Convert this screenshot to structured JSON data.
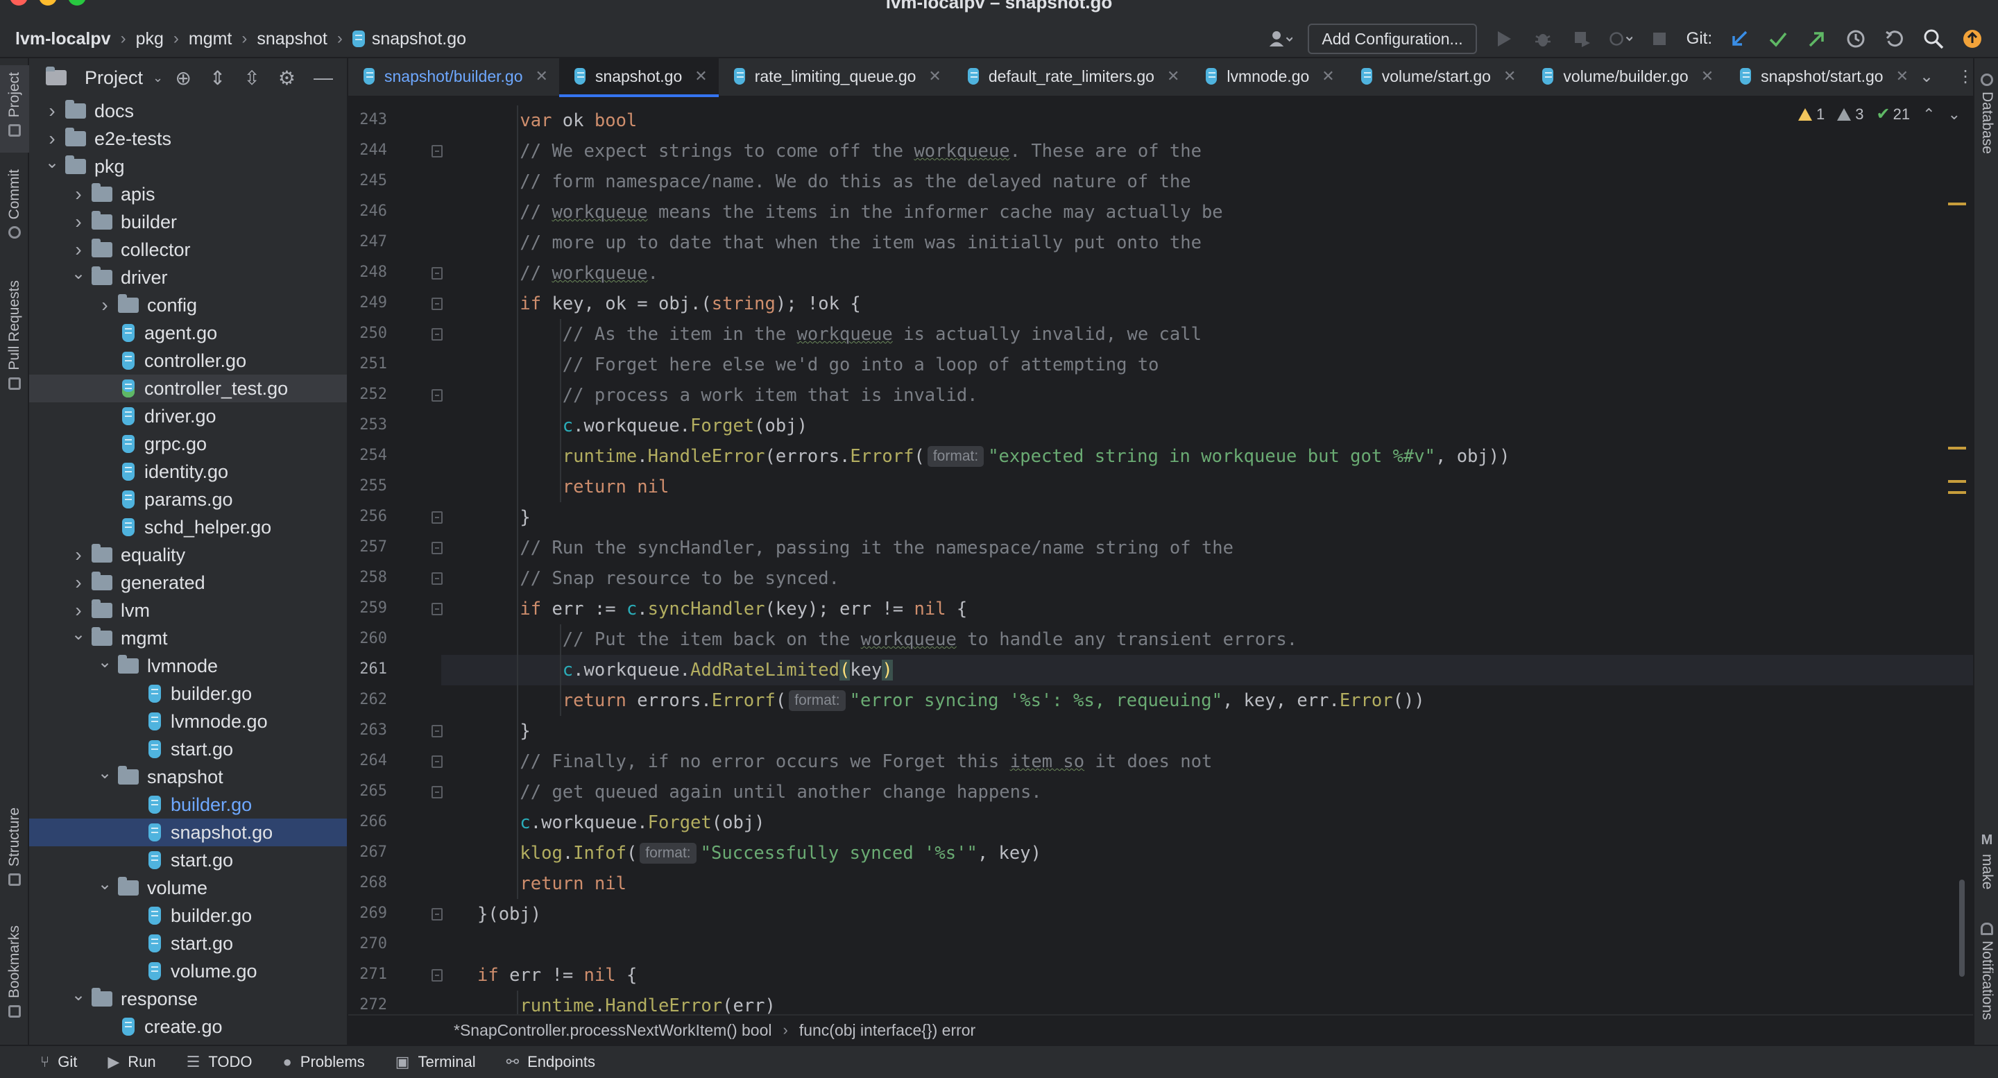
{
  "window": {
    "title": "lvm-localpv – snapshot.go"
  },
  "navbar": {
    "crumbs": [
      "lvm-localpv",
      "pkg",
      "mgmt",
      "snapshot",
      "snapshot.go"
    ],
    "add_configuration": "Add Configuration...",
    "git_label": "Git:"
  },
  "left_stripe": {
    "tabs": [
      "Project",
      "Commit",
      "Pull Requests",
      "Structure",
      "Bookmarks"
    ]
  },
  "right_stripe": {
    "tabs": [
      "Database",
      "make",
      "Notifications"
    ]
  },
  "project_panel": {
    "title": "Project",
    "tree": [
      {
        "label": "docs",
        "type": "folder",
        "depth": 0,
        "open": false
      },
      {
        "label": "e2e-tests",
        "type": "folder",
        "depth": 0,
        "open": false
      },
      {
        "label": "pkg",
        "type": "folder",
        "depth": 0,
        "open": true
      },
      {
        "label": "apis",
        "type": "folder",
        "depth": 1,
        "open": false
      },
      {
        "label": "builder",
        "type": "folder",
        "depth": 1,
        "open": false
      },
      {
        "label": "collector",
        "type": "folder",
        "depth": 1,
        "open": false
      },
      {
        "label": "driver",
        "type": "folder",
        "depth": 1,
        "open": true
      },
      {
        "label": "config",
        "type": "folder",
        "depth": 2,
        "open": false
      },
      {
        "label": "agent.go",
        "type": "go",
        "depth": 2
      },
      {
        "label": "controller.go",
        "type": "go",
        "depth": 2
      },
      {
        "label": "controller_test.go",
        "type": "go-test",
        "depth": 2,
        "state": "hover"
      },
      {
        "label": "driver.go",
        "type": "go",
        "depth": 2
      },
      {
        "label": "grpc.go",
        "type": "go",
        "depth": 2
      },
      {
        "label": "identity.go",
        "type": "go",
        "depth": 2
      },
      {
        "label": "params.go",
        "type": "go",
        "depth": 2
      },
      {
        "label": "schd_helper.go",
        "type": "go",
        "depth": 2
      },
      {
        "label": "equality",
        "type": "folder",
        "depth": 1,
        "open": false
      },
      {
        "label": "generated",
        "type": "folder",
        "depth": 1,
        "open": false
      },
      {
        "label": "lvm",
        "type": "folder",
        "depth": 1,
        "open": false
      },
      {
        "label": "mgmt",
        "type": "folder",
        "depth": 1,
        "open": true
      },
      {
        "label": "lvmnode",
        "type": "folder",
        "depth": 2,
        "open": true
      },
      {
        "label": "builder.go",
        "type": "go",
        "depth": 3
      },
      {
        "label": "lvmnode.go",
        "type": "go",
        "depth": 3
      },
      {
        "label": "start.go",
        "type": "go",
        "depth": 3
      },
      {
        "label": "snapshot",
        "type": "folder",
        "depth": 2,
        "open": true
      },
      {
        "label": "builder.go",
        "type": "go",
        "depth": 3,
        "state": "link"
      },
      {
        "label": "snapshot.go",
        "type": "go",
        "depth": 3,
        "state": "selected"
      },
      {
        "label": "start.go",
        "type": "go",
        "depth": 3
      },
      {
        "label": "volume",
        "type": "folder",
        "depth": 2,
        "open": true
      },
      {
        "label": "builder.go",
        "type": "go",
        "depth": 3
      },
      {
        "label": "start.go",
        "type": "go",
        "depth": 3
      },
      {
        "label": "volume.go",
        "type": "go",
        "depth": 3
      },
      {
        "label": "response",
        "type": "folder",
        "depth": 1,
        "open": true
      },
      {
        "label": "create.go",
        "type": "go",
        "depth": 2
      }
    ]
  },
  "tabs": [
    {
      "label": "snapshot/builder.go",
      "state": "blue"
    },
    {
      "label": "snapshot.go",
      "state": "active"
    },
    {
      "label": "rate_limiting_queue.go",
      "state": "normal"
    },
    {
      "label": "default_rate_limiters.go",
      "state": "normal"
    },
    {
      "label": "lvmnode.go",
      "state": "normal"
    },
    {
      "label": "volume/start.go",
      "state": "normal"
    },
    {
      "label": "volume/builder.go",
      "state": "normal"
    },
    {
      "label": "snapshot/start.go",
      "state": "normal"
    }
  ],
  "inspections": {
    "warnings": "1",
    "weak_warnings": "3",
    "ok": "21"
  },
  "editor": {
    "current_line": 261,
    "lines": [
      {
        "n": 243,
        "indent": 2,
        "fold": false,
        "tokens": [
          [
            "kw",
            "var"
          ],
          [
            "ident",
            " ok "
          ],
          [
            "kw",
            "bool"
          ]
        ]
      },
      {
        "n": 244,
        "indent": 2,
        "fold": true,
        "tokens": [
          [
            "cm",
            "// We expect strings to come off the "
          ],
          [
            "cmtypo",
            "workqueue"
          ],
          [
            "cm",
            ". These are of the"
          ]
        ]
      },
      {
        "n": 245,
        "indent": 2,
        "fold": false,
        "tokens": [
          [
            "cm",
            "// form namespace/name. We do this as the delayed nature of the"
          ]
        ]
      },
      {
        "n": 246,
        "indent": 2,
        "fold": false,
        "tokens": [
          [
            "cm",
            "// "
          ],
          [
            "cmtypo",
            "workqueue"
          ],
          [
            "cm",
            " means the items in the informer cache may actually be"
          ]
        ]
      },
      {
        "n": 247,
        "indent": 2,
        "fold": false,
        "tokens": [
          [
            "cm",
            "// more up to date that when the item was initially put onto the"
          ]
        ]
      },
      {
        "n": 248,
        "indent": 2,
        "fold": true,
        "tokens": [
          [
            "cm",
            "// "
          ],
          [
            "cmtypo",
            "workqueue"
          ],
          [
            "cm",
            "."
          ]
        ]
      },
      {
        "n": 249,
        "indent": 2,
        "fold": true,
        "tokens": [
          [
            "kw",
            "if"
          ],
          [
            "ident",
            " key, ok = obj.("
          ],
          [
            "kw",
            "string"
          ],
          [
            "ident",
            "); !ok {"
          ]
        ]
      },
      {
        "n": 250,
        "indent": 3,
        "fold": true,
        "tokens": [
          [
            "cm",
            "// As the item in the "
          ],
          [
            "cmtypo",
            "workqueue"
          ],
          [
            "cm",
            " is actually invalid, we call"
          ]
        ]
      },
      {
        "n": 251,
        "indent": 3,
        "fold": false,
        "tokens": [
          [
            "cm",
            "// Forget here else we'd go into a loop of attempting to"
          ]
        ]
      },
      {
        "n": 252,
        "indent": 3,
        "fold": true,
        "tokens": [
          [
            "cm",
            "// process a work item that is invalid."
          ]
        ]
      },
      {
        "n": 253,
        "indent": 3,
        "fold": false,
        "tokens": [
          [
            "cyan",
            "c"
          ],
          [
            "ident",
            "."
          ],
          [
            "ident",
            "workqueue."
          ],
          [
            "golden",
            "Forget"
          ],
          [
            "ident",
            "(obj)"
          ]
        ]
      },
      {
        "n": 254,
        "indent": 3,
        "fold": false,
        "tokens": [
          [
            "golden",
            "runtime"
          ],
          [
            "ident",
            "."
          ],
          [
            "golden",
            "HandleError"
          ],
          [
            "ident",
            "(errors."
          ],
          [
            "golden",
            "Errorf"
          ],
          [
            "ident",
            "("
          ],
          [
            "hint",
            "format:"
          ],
          [
            "str",
            "\"expected string in workqueue but got %#v\""
          ],
          [
            "ident",
            ", obj))"
          ]
        ]
      },
      {
        "n": 255,
        "indent": 3,
        "fold": false,
        "tokens": [
          [
            "kw",
            "return"
          ],
          [
            "ident",
            " "
          ],
          [
            "kw",
            "nil"
          ]
        ]
      },
      {
        "n": 256,
        "indent": 2,
        "fold": true,
        "tokens": [
          [
            "ident",
            "}"
          ]
        ]
      },
      {
        "n": 257,
        "indent": 2,
        "fold": true,
        "tokens": [
          [
            "cm",
            "// Run the syncHandler, passing it the namespace/name string of the"
          ]
        ]
      },
      {
        "n": 258,
        "indent": 2,
        "fold": true,
        "tokens": [
          [
            "cm",
            "// Snap resource to be synced."
          ]
        ]
      },
      {
        "n": 259,
        "indent": 2,
        "fold": true,
        "tokens": [
          [
            "kw",
            "if"
          ],
          [
            "ident",
            " err := "
          ],
          [
            "cyan",
            "c"
          ],
          [
            "ident",
            "."
          ],
          [
            "golden",
            "syncHandler"
          ],
          [
            "ident",
            "(key); err != "
          ],
          [
            "kw",
            "nil"
          ],
          [
            "ident",
            " {"
          ]
        ]
      },
      {
        "n": 260,
        "indent": 3,
        "fold": false,
        "tokens": [
          [
            "cm",
            "// Put the item back on the "
          ],
          [
            "cmtypo",
            "workqueue"
          ],
          [
            "cm",
            " to handle any transient errors."
          ]
        ]
      },
      {
        "n": 261,
        "indent": 3,
        "fold": false,
        "tokens": [
          [
            "cyan",
            "c"
          ],
          [
            "ident",
            "."
          ],
          [
            "ident",
            "workqueue."
          ],
          [
            "golden",
            "AddRateLimited"
          ],
          [
            "bracehl",
            "("
          ],
          [
            "ident",
            "key"
          ],
          [
            "bracehl",
            ")"
          ]
        ]
      },
      {
        "n": 262,
        "indent": 3,
        "fold": false,
        "tokens": [
          [
            "kw",
            "return"
          ],
          [
            "ident",
            " errors."
          ],
          [
            "golden",
            "Errorf"
          ],
          [
            "ident",
            "("
          ],
          [
            "hint",
            "format:"
          ],
          [
            "str",
            "\"error syncing '%s': %s, requeuing\""
          ],
          [
            "ident",
            ", key, err."
          ],
          [
            "golden",
            "Error"
          ],
          [
            "ident",
            "())"
          ]
        ]
      },
      {
        "n": 263,
        "indent": 2,
        "fold": true,
        "tokens": [
          [
            "ident",
            "}"
          ]
        ]
      },
      {
        "n": 264,
        "indent": 2,
        "fold": true,
        "tokens": [
          [
            "cm",
            "// Finally, if no error occurs we Forget this "
          ],
          [
            "cmtypo",
            "item so"
          ],
          [
            "cm",
            " it does not"
          ]
        ]
      },
      {
        "n": 265,
        "indent": 2,
        "fold": true,
        "tokens": [
          [
            "cm",
            "// get queued again until another change happens."
          ]
        ]
      },
      {
        "n": 266,
        "indent": 2,
        "fold": false,
        "tokens": [
          [
            "cyan",
            "c"
          ],
          [
            "ident",
            "."
          ],
          [
            "ident",
            "workqueue."
          ],
          [
            "golden",
            "Forget"
          ],
          [
            "ident",
            "(obj)"
          ]
        ]
      },
      {
        "n": 267,
        "indent": 2,
        "fold": false,
        "tokens": [
          [
            "golden",
            "klog"
          ],
          [
            "ident",
            "."
          ],
          [
            "golden",
            "Infof"
          ],
          [
            "ident",
            "("
          ],
          [
            "hint",
            "format:"
          ],
          [
            "str",
            "\"Successfully synced '%s'\""
          ],
          [
            "ident",
            ", key)"
          ]
        ]
      },
      {
        "n": 268,
        "indent": 2,
        "fold": false,
        "tokens": [
          [
            "kw",
            "return"
          ],
          [
            "ident",
            " "
          ],
          [
            "kw",
            "nil"
          ]
        ]
      },
      {
        "n": 269,
        "indent": 1,
        "fold": true,
        "tokens": [
          [
            "ident",
            "}(obj)"
          ]
        ]
      },
      {
        "n": 270,
        "indent": 1,
        "fold": false,
        "tokens": []
      },
      {
        "n": 271,
        "indent": 1,
        "fold": true,
        "tokens": [
          [
            "kw",
            "if"
          ],
          [
            "ident",
            " err != "
          ],
          [
            "kw",
            "nil"
          ],
          [
            "ident",
            " {"
          ]
        ]
      },
      {
        "n": 272,
        "indent": 2,
        "fold": false,
        "tokens": [
          [
            "golden",
            "runtime"
          ],
          [
            "ident",
            "."
          ],
          [
            "golden",
            "HandleError"
          ],
          [
            "ident",
            "(err)"
          ]
        ]
      }
    ]
  },
  "breadcrumb_bar": [
    "*SnapController.processNextWorkItem() bool",
    "func(obj interface{}) error"
  ],
  "bottom_tools": [
    {
      "label": "Git",
      "icon": "git-branch-icon"
    },
    {
      "label": "Run",
      "icon": "play-icon"
    },
    {
      "label": "TODO",
      "icon": "list-icon"
    },
    {
      "label": "Problems",
      "icon": "problems-icon"
    },
    {
      "label": "Terminal",
      "icon": "terminal-icon"
    },
    {
      "label": "Endpoints",
      "icon": "endpoints-icon"
    }
  ],
  "colors": {
    "bg": "#1e1f22",
    "panel": "#2b2d30",
    "selection": "#2e436e",
    "accent": "#3574f0",
    "keyword": "#cf8e6d",
    "comment": "#7a7e85",
    "string": "#6aab73"
  }
}
